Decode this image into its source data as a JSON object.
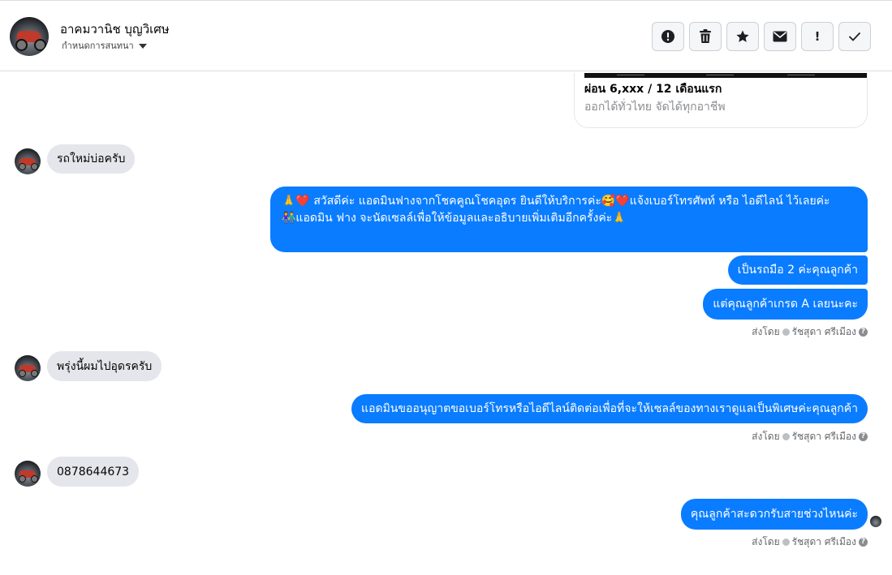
{
  "header": {
    "contact_name": "อาคมวานิช บุญวิเศษ",
    "assign_label": "กำหนดการสนทนา",
    "toolbar_icons": [
      "alert-circle-icon",
      "trash-icon",
      "star-icon",
      "envelope-icon",
      "exclamation-icon",
      "checkmark-icon"
    ],
    "exclamation_glyph": "!",
    "check_glyph": "✓"
  },
  "link_card": {
    "title": "ผ่อน 6,xxx / 12 เดือนแรก",
    "subtitle": "ออกได้ทั่วไทย จัดได้ทุกอาชีพ"
  },
  "messages": {
    "m1": "รถใหม่บ่อครับ",
    "m2_line1": "🙏❤️ สวัสดีค่ะ แอดมินฟางจากโชคคูณโชคอุดร ยินดีให้บริการค่ะ🥰❤️แจ้งเบอร์โทรศัพท์ หรือ ไอดีไลน์  ไว้เลยค่ะ",
    "m2_line2": "👫แอดมิน ฟาง จะนัดเซลล์เพื่อให้ข้อมูลและอธิบายเพิ่มเติมอีกครั้งค่ะ🙏",
    "m3": "เป็นรถมือ 2 ค่ะคุณลูกค้า",
    "m4": "แต่คุณลูกค้าเกรด A เลยนะคะ",
    "m5": "พรุ่งนี้ผมไปอุดรครับ",
    "m6": "แอดมินขออนุญาตขอเบอร์โทรหรือไอดีไลน์ติดต่อเพื่อที่จะให้เซลล์ของทางเราดูแลเป็นพิเศษค่ะคุณลูกค้า",
    "m7": "0878644673",
    "m8": "คุณลูกค้าสะดวกรับสายช่วงไหนค่ะ"
  },
  "sent_by": {
    "label": "ส่งโดย",
    "name": "รัชสุดา ศรีเมือง",
    "help_glyph": "?"
  },
  "colors": {
    "outgoing_bubble": "#0a7cff",
    "incoming_bubble": "#e4e6eb"
  }
}
